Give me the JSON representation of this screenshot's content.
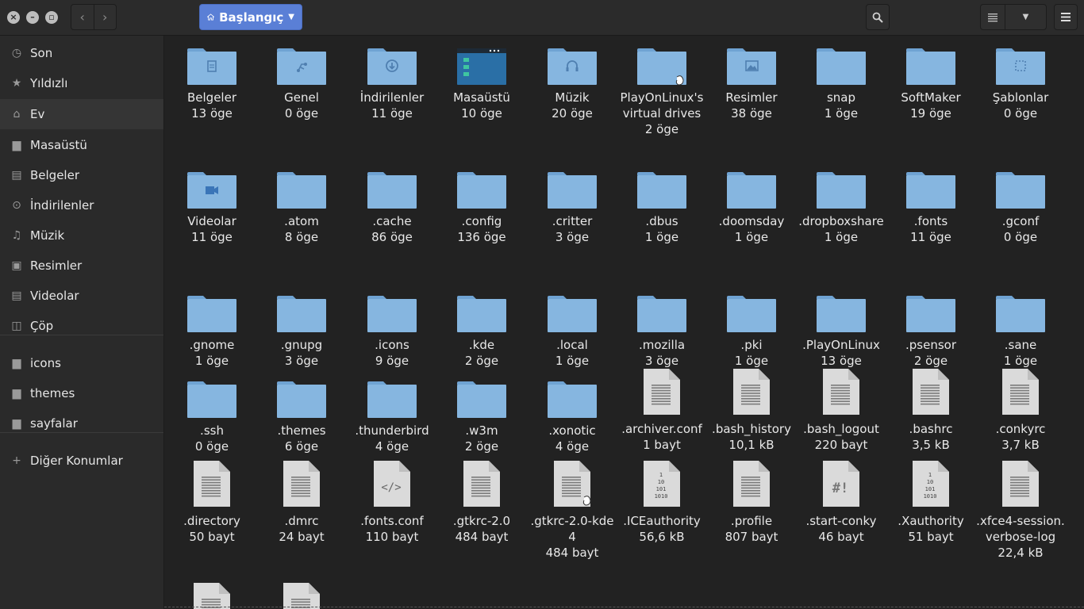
{
  "window": {
    "path_label": "Başlangıç",
    "colors": {
      "accent": "#5a7fd6",
      "folder": "#86b6e0",
      "folder_tab": "#6fa3d3",
      "file": "#dadada",
      "bg": "#222222",
      "sidebar": "#2a2a2a"
    }
  },
  "sidebar": {
    "items": [
      {
        "label": "Son",
        "icon": "clock-icon",
        "glyph": "◷"
      },
      {
        "label": "Yıldızlı",
        "icon": "star-icon",
        "glyph": "★"
      },
      {
        "label": "Ev",
        "icon": "home-icon",
        "glyph": "⌂"
      },
      {
        "label": "Masaüstü",
        "icon": "folder-icon",
        "glyph": "▆"
      },
      {
        "label": "Belgeler",
        "icon": "document-icon",
        "glyph": "▤"
      },
      {
        "label": "İndirilenler",
        "icon": "download-icon",
        "glyph": "⊙"
      },
      {
        "label": "Müzik",
        "icon": "music-icon",
        "glyph": "♫"
      },
      {
        "label": "Resimler",
        "icon": "picture-icon",
        "glyph": "▣"
      },
      {
        "label": "Videolar",
        "icon": "video-icon",
        "glyph": "▤"
      },
      {
        "label": "Çöp",
        "icon": "trash-icon",
        "glyph": "◫"
      },
      {
        "label": "icons",
        "icon": "folder-icon",
        "glyph": "▆"
      },
      {
        "label": "themes",
        "icon": "folder-icon",
        "glyph": "▆"
      },
      {
        "label": "sayfalar",
        "icon": "folder-icon",
        "glyph": "▆"
      },
      {
        "label": "Diğer Konumlar",
        "icon": "plus-icon",
        "glyph": "+"
      }
    ]
  },
  "files": [
    {
      "name": "Belgeler",
      "count": "13 öge",
      "kind": "folder",
      "emblem": "document"
    },
    {
      "name": "Genel",
      "count": "0 öge",
      "kind": "folder",
      "emblem": "share"
    },
    {
      "name": "İndirilenler",
      "count": "11 öge",
      "kind": "folder",
      "emblem": "download"
    },
    {
      "name": "Masaüstü",
      "count": "10 öge",
      "kind": "desktop",
      "emblem": ""
    },
    {
      "name": "Müzik",
      "count": "20 öge",
      "kind": "folder",
      "emblem": "music"
    },
    {
      "name": "PlayOnLinux's virtual drives",
      "count": "2 öge",
      "kind": "folder",
      "emblem": "link"
    },
    {
      "name": "Resimler",
      "count": "38 öge",
      "kind": "folder",
      "emblem": "picture"
    },
    {
      "name": "snap",
      "count": "1 öge",
      "kind": "folder",
      "emblem": ""
    },
    {
      "name": "SoftMaker",
      "count": "19 öge",
      "kind": "folder",
      "emblem": ""
    },
    {
      "name": "Şablonlar",
      "count": "0 öge",
      "kind": "folder",
      "emblem": "template"
    },
    {
      "name": "Videolar",
      "count": "11 öge",
      "kind": "folder",
      "emblem": "video"
    },
    {
      "name": ".atom",
      "count": "8 öge",
      "kind": "folder",
      "emblem": ""
    },
    {
      "name": ".cache",
      "count": "86 öge",
      "kind": "folder",
      "emblem": ""
    },
    {
      "name": ".config",
      "count": "136 öge",
      "kind": "folder",
      "emblem": ""
    },
    {
      "name": ".critter",
      "count": "3 öge",
      "kind": "folder",
      "emblem": ""
    },
    {
      "name": ".dbus",
      "count": "1 öge",
      "kind": "folder",
      "emblem": ""
    },
    {
      "name": ".doomsday",
      "count": "1 öge",
      "kind": "folder",
      "emblem": ""
    },
    {
      "name": ".dropboxshare",
      "count": "1 öge",
      "kind": "folder",
      "emblem": ""
    },
    {
      "name": ".fonts",
      "count": "11 öge",
      "kind": "folder",
      "emblem": ""
    },
    {
      "name": ".gconf",
      "count": "0 öge",
      "kind": "folder",
      "emblem": ""
    },
    {
      "name": ".gnome",
      "count": "1 öge",
      "kind": "folder",
      "emblem": ""
    },
    {
      "name": ".gnupg",
      "count": "3 öge",
      "kind": "folder",
      "emblem": ""
    },
    {
      "name": ".icons",
      "count": "9 öge",
      "kind": "folder",
      "emblem": ""
    },
    {
      "name": ".kde",
      "count": "2 öge",
      "kind": "folder",
      "emblem": ""
    },
    {
      "name": ".local",
      "count": "1 öge",
      "kind": "folder",
      "emblem": ""
    },
    {
      "name": ".mozilla",
      "count": "3 öge",
      "kind": "folder",
      "emblem": ""
    },
    {
      "name": ".pki",
      "count": "1 öge",
      "kind": "folder",
      "emblem": ""
    },
    {
      "name": ".PlayOnLinux",
      "count": "13 öge",
      "kind": "folder",
      "emblem": ""
    },
    {
      "name": ".psensor",
      "count": "2 öge",
      "kind": "folder",
      "emblem": ""
    },
    {
      "name": ".sane",
      "count": "1 öge",
      "kind": "folder",
      "emblem": ""
    },
    {
      "name": ".ssh",
      "count": "0 öge",
      "kind": "folder",
      "emblem": ""
    },
    {
      "name": ".themes",
      "count": "6 öge",
      "kind": "folder",
      "emblem": ""
    },
    {
      "name": ".thunderbird",
      "count": "4 öge",
      "kind": "folder",
      "emblem": ""
    },
    {
      "name": ".w3m",
      "count": "2 öge",
      "kind": "folder",
      "emblem": ""
    },
    {
      "name": ".xonotic",
      "count": "4 öge",
      "kind": "folder",
      "emblem": ""
    },
    {
      "name": ".archiver.conf",
      "count": "1 bayt",
      "kind": "text",
      "emblem": ""
    },
    {
      "name": ".bash_history",
      "count": "10,1 kB",
      "kind": "text",
      "emblem": ""
    },
    {
      "name": ".bash_logout",
      "count": "220 bayt",
      "kind": "text",
      "emblem": ""
    },
    {
      "name": ".bashrc",
      "count": "3,5 kB",
      "kind": "text",
      "emblem": ""
    },
    {
      "name": ".conkyrc",
      "count": "3,7 kB",
      "kind": "text",
      "emblem": ""
    },
    {
      "name": ".directory",
      "count": "50 bayt",
      "kind": "text",
      "emblem": ""
    },
    {
      "name": ".dmrc",
      "count": "24 bayt",
      "kind": "text",
      "emblem": ""
    },
    {
      "name": ".fonts.conf",
      "count": "110 bayt",
      "kind": "code",
      "emblem": ""
    },
    {
      "name": ".gtkrc-2.0",
      "count": "484 bayt",
      "kind": "text",
      "emblem": ""
    },
    {
      "name": ".gtkrc-2.0-kde4",
      "count": "484 bayt",
      "kind": "text",
      "emblem": "link"
    },
    {
      "name": ".ICEauthority",
      "count": "56,6 kB",
      "kind": "binary",
      "emblem": ""
    },
    {
      "name": ".profile",
      "count": "807 bayt",
      "kind": "text",
      "emblem": ""
    },
    {
      "name": ".start-conky",
      "count": "46 bayt",
      "kind": "script",
      "emblem": ""
    },
    {
      "name": ".Xauthority",
      "count": "51 bayt",
      "kind": "binary",
      "emblem": ""
    },
    {
      "name": ".xfce4-session.verbose-log",
      "count": "22,4 kB",
      "kind": "text",
      "emblem": ""
    },
    {
      "name": "",
      "count": "",
      "kind": "text",
      "emblem": ""
    },
    {
      "name": "",
      "count": "",
      "kind": "text",
      "emblem": ""
    }
  ]
}
